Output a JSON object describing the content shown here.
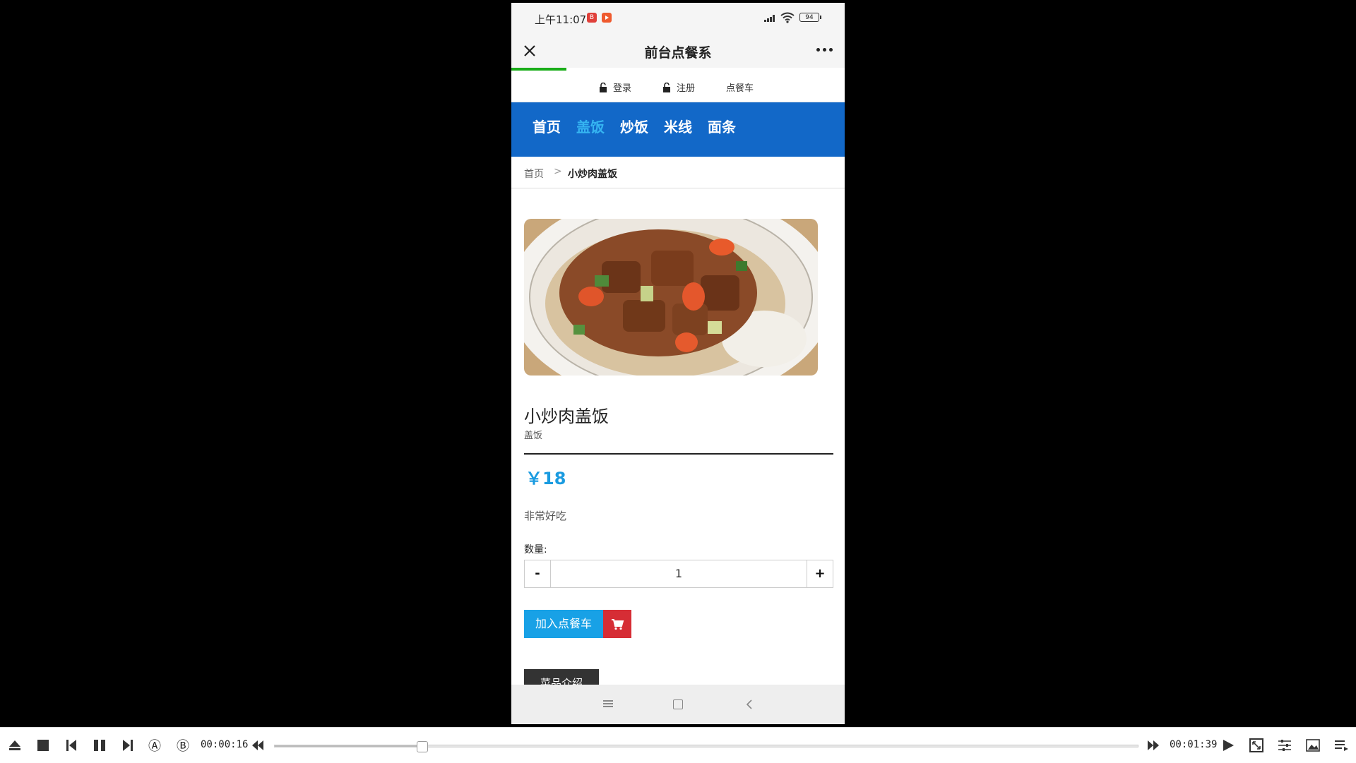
{
  "status": {
    "time": "上午11:07",
    "battery": "94"
  },
  "titlebar": {
    "title": "前台点餐系"
  },
  "topnav": {
    "login": "登录",
    "register": "注册",
    "cart": "点餐车"
  },
  "mainnav": {
    "items": [
      "首页",
      "盖饭",
      "炒饭",
      "米线",
      "面条"
    ],
    "active_index": 1
  },
  "breadcrumb": {
    "home": "首页",
    "separator": ">",
    "current": "小炒肉盖饭"
  },
  "product": {
    "name": "小炒肉盖饭",
    "category": "盖饭",
    "price": "￥18",
    "description": "非常好吃",
    "quantity_label": "数量:",
    "quantity": "1",
    "minus_label": "-",
    "plus_label": "+",
    "add_to_cart_label": "加入点餐车",
    "intro_tab_label": "菜品介绍"
  },
  "player": {
    "current_time": "00:00:16",
    "total_time": "00:01:39",
    "progress": 0.17,
    "a_label": "Ⓐ",
    "b_label": "Ⓑ"
  },
  "colors": {
    "nav_bg": "#1268c8",
    "nav_active": "#35b4f1",
    "price": "#1a9be0",
    "cart_btn": "#18a1e6",
    "cart_icon_bg": "#d62d35",
    "wechat_progress": "#1aad19"
  }
}
